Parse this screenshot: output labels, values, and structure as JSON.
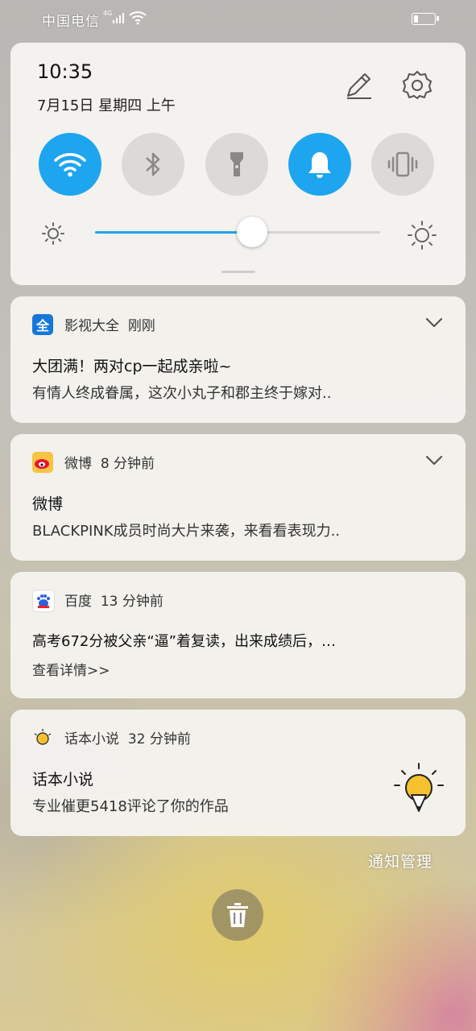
{
  "status_bar": {
    "carrier": "中国电信",
    "network": "4G"
  },
  "quick_panel": {
    "time": "10:35",
    "date": "7月15日 星期四 上午",
    "toggles": [
      {
        "icon": "wifi-icon",
        "state": "on"
      },
      {
        "icon": "bluetooth-icon",
        "state": "off"
      },
      {
        "icon": "flashlight-icon",
        "state": "off"
      },
      {
        "icon": "bell-icon",
        "state": "on"
      },
      {
        "icon": "vibrate-icon",
        "state": "off"
      }
    ],
    "brightness_fraction": 0.55,
    "accent_color": "#1ea5ef"
  },
  "notifications": [
    {
      "app": "影视大全",
      "time": "刚刚",
      "title": "大团满！两对cp一起成亲啦~",
      "body": "有情人终成眷属，这次小丸子和郡主终于嫁对.."
    },
    {
      "app": "微博",
      "time": "8 分钟前",
      "title": "微博",
      "body": "BLACKPINK成员时尚大片来袭，来看看表现力.."
    },
    {
      "app": "百度",
      "time": "13 分钟前",
      "title": "高考672分被父亲“逼”着复读，出来成绩后，…",
      "more": "查看详情>>"
    },
    {
      "app": "话本小说",
      "time": "32 分钟前",
      "title": "话本小说",
      "body": "专业催更5418评论了你的作品"
    }
  ],
  "footer": {
    "manage_label": "通知管理"
  }
}
